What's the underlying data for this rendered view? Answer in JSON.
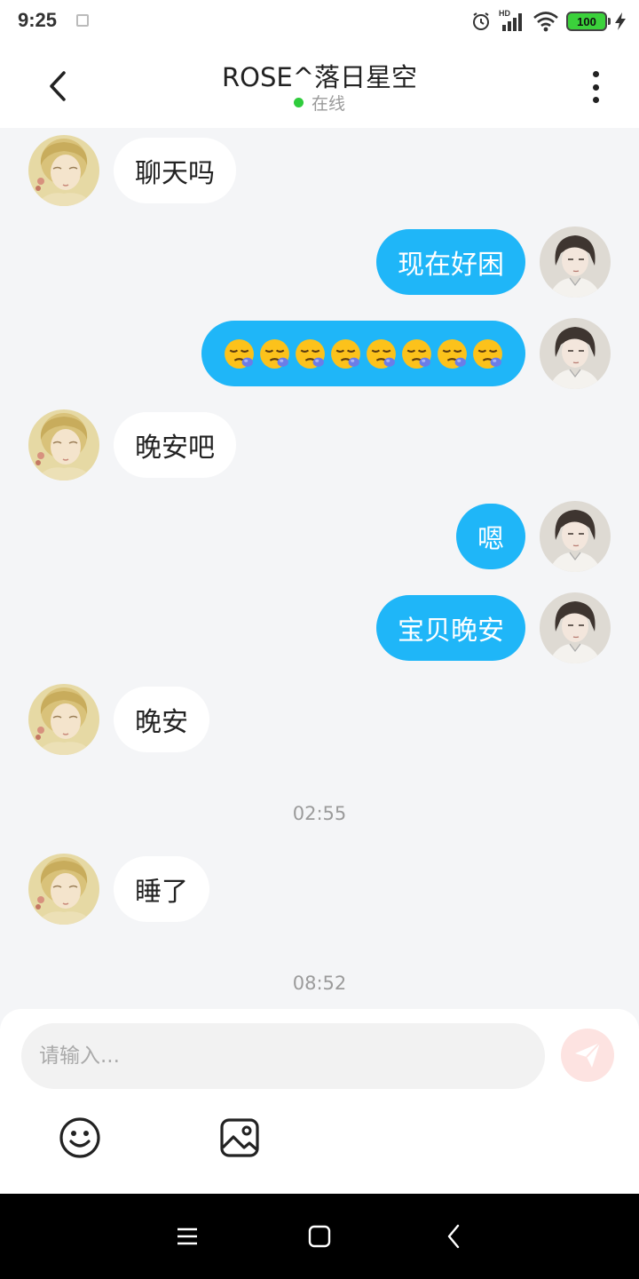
{
  "status_bar": {
    "time": "9:25",
    "network_label": "HD",
    "battery_level": "100",
    "icons": [
      "alarm-icon",
      "signal-icon",
      "wifi-icon",
      "battery-icon",
      "charging-icon"
    ]
  },
  "header": {
    "contact_name": "ROSE^落日星空",
    "status_text": "在线",
    "status_color": "#2fcc3c",
    "back_icon": "chevron-left-icon",
    "more_icon": "more-vertical-icon"
  },
  "colors": {
    "background": "#f4f5f7",
    "sent_bubble": "#1fb6f8",
    "received_bubble": "#ffffff",
    "send_button": "#fde3e1"
  },
  "messages": [
    {
      "side": "received",
      "text": "聊天吗"
    },
    {
      "side": "sent",
      "text": "现在好困"
    },
    {
      "side": "sent",
      "emoji": "sleepy-face",
      "emoji_count": 8
    },
    {
      "side": "received",
      "text": "晚安吧"
    },
    {
      "side": "sent",
      "text": "嗯"
    },
    {
      "side": "sent",
      "text": "宝贝晚安"
    },
    {
      "side": "received",
      "text": "晚安"
    },
    {
      "side": "received",
      "text": "睡了"
    }
  ],
  "timestamps": [
    "02:55",
    "08:52"
  ],
  "input": {
    "placeholder": "请输入...",
    "value": "",
    "send_icon": "paper-plane-icon",
    "tools": [
      "smiley-icon",
      "image-icon"
    ]
  },
  "nav_bar": {
    "buttons": [
      "menu-icon",
      "home-icon",
      "back-icon"
    ]
  }
}
